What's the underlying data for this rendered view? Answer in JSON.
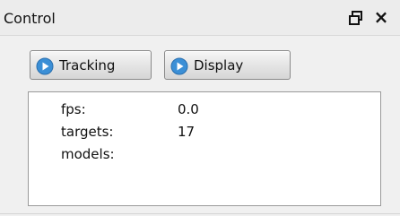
{
  "window": {
    "title": "Control",
    "float_icon": "float-window-icon",
    "close_label": "×"
  },
  "toolbar": {
    "tracking_label": "Tracking",
    "display_label": "Display",
    "button_icon": "play-circle-icon",
    "accent": "#3b8fd6"
  },
  "stats": {
    "rows": [
      {
        "label": "fps:",
        "value": "0.0"
      },
      {
        "label": "targets:",
        "value": "17"
      },
      {
        "label": "models:",
        "value": ""
      }
    ]
  }
}
